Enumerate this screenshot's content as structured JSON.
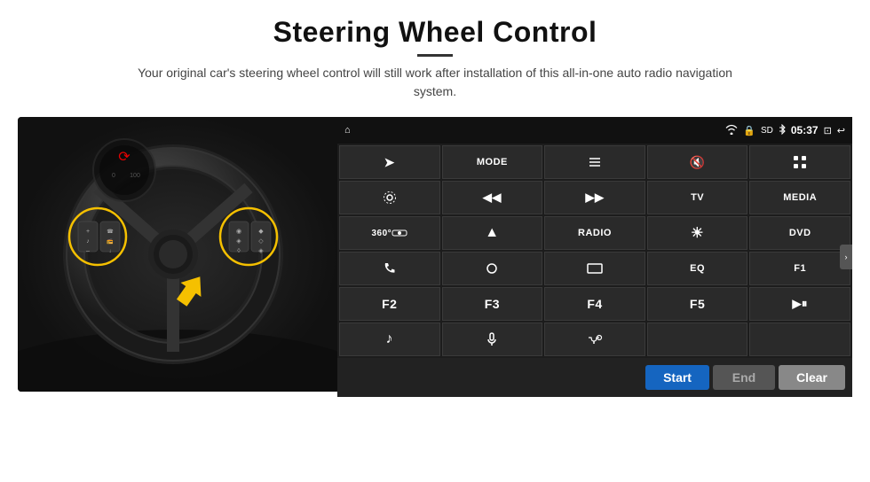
{
  "header": {
    "title": "Steering Wheel Control",
    "subtitle": "Your original car's steering wheel control will still work after installation of this all-in-one auto radio navigation system."
  },
  "status_bar": {
    "home_icon": "⌂",
    "wifi_icon": "WiFi",
    "lock_icon": "🔒",
    "sd_icon": "SD",
    "bt_icon": "BT",
    "time": "05:37",
    "window_icon": "⊡",
    "back_icon": "↩"
  },
  "button_grid": [
    {
      "id": "nav",
      "icon": "➤",
      "label": ""
    },
    {
      "id": "mode",
      "icon": "",
      "label": "MODE"
    },
    {
      "id": "list",
      "icon": "≡",
      "label": ""
    },
    {
      "id": "mute",
      "icon": "🔇",
      "label": ""
    },
    {
      "id": "apps",
      "icon": "⋯",
      "label": ""
    },
    {
      "id": "settings",
      "icon": "⚙",
      "label": ""
    },
    {
      "id": "prev",
      "icon": "◀|◀",
      "label": ""
    },
    {
      "id": "next",
      "icon": "▶|▶",
      "label": ""
    },
    {
      "id": "tv",
      "icon": "",
      "label": "TV"
    },
    {
      "id": "media",
      "icon": "",
      "label": "MEDIA"
    },
    {
      "id": "cam360",
      "icon": "360°",
      "label": ""
    },
    {
      "id": "eject",
      "icon": "▲",
      "label": ""
    },
    {
      "id": "radio",
      "icon": "",
      "label": "RADIO"
    },
    {
      "id": "brightness",
      "icon": "☀",
      "label": ""
    },
    {
      "id": "dvd",
      "icon": "",
      "label": "DVD"
    },
    {
      "id": "phone",
      "icon": "📞",
      "label": ""
    },
    {
      "id": "swirl",
      "icon": "◎",
      "label": ""
    },
    {
      "id": "screen",
      "icon": "▭",
      "label": ""
    },
    {
      "id": "eq",
      "icon": "",
      "label": "EQ"
    },
    {
      "id": "f1",
      "icon": "",
      "label": "F1"
    },
    {
      "id": "f2",
      "icon": "",
      "label": "F2"
    },
    {
      "id": "f3",
      "icon": "",
      "label": "F3"
    },
    {
      "id": "f4",
      "icon": "",
      "label": "F4"
    },
    {
      "id": "f5",
      "icon": "",
      "label": "F5"
    },
    {
      "id": "playpause",
      "icon": "▶⏸",
      "label": ""
    },
    {
      "id": "music",
      "icon": "♪",
      "label": ""
    },
    {
      "id": "mic",
      "icon": "🎤",
      "label": ""
    },
    {
      "id": "handsfree",
      "icon": "📞/–",
      "label": ""
    },
    {
      "id": "empty1",
      "icon": "",
      "label": ""
    },
    {
      "id": "empty2",
      "icon": "",
      "label": ""
    }
  ],
  "bottom_buttons": {
    "start": "Start",
    "end": "End",
    "clear": "Clear"
  }
}
